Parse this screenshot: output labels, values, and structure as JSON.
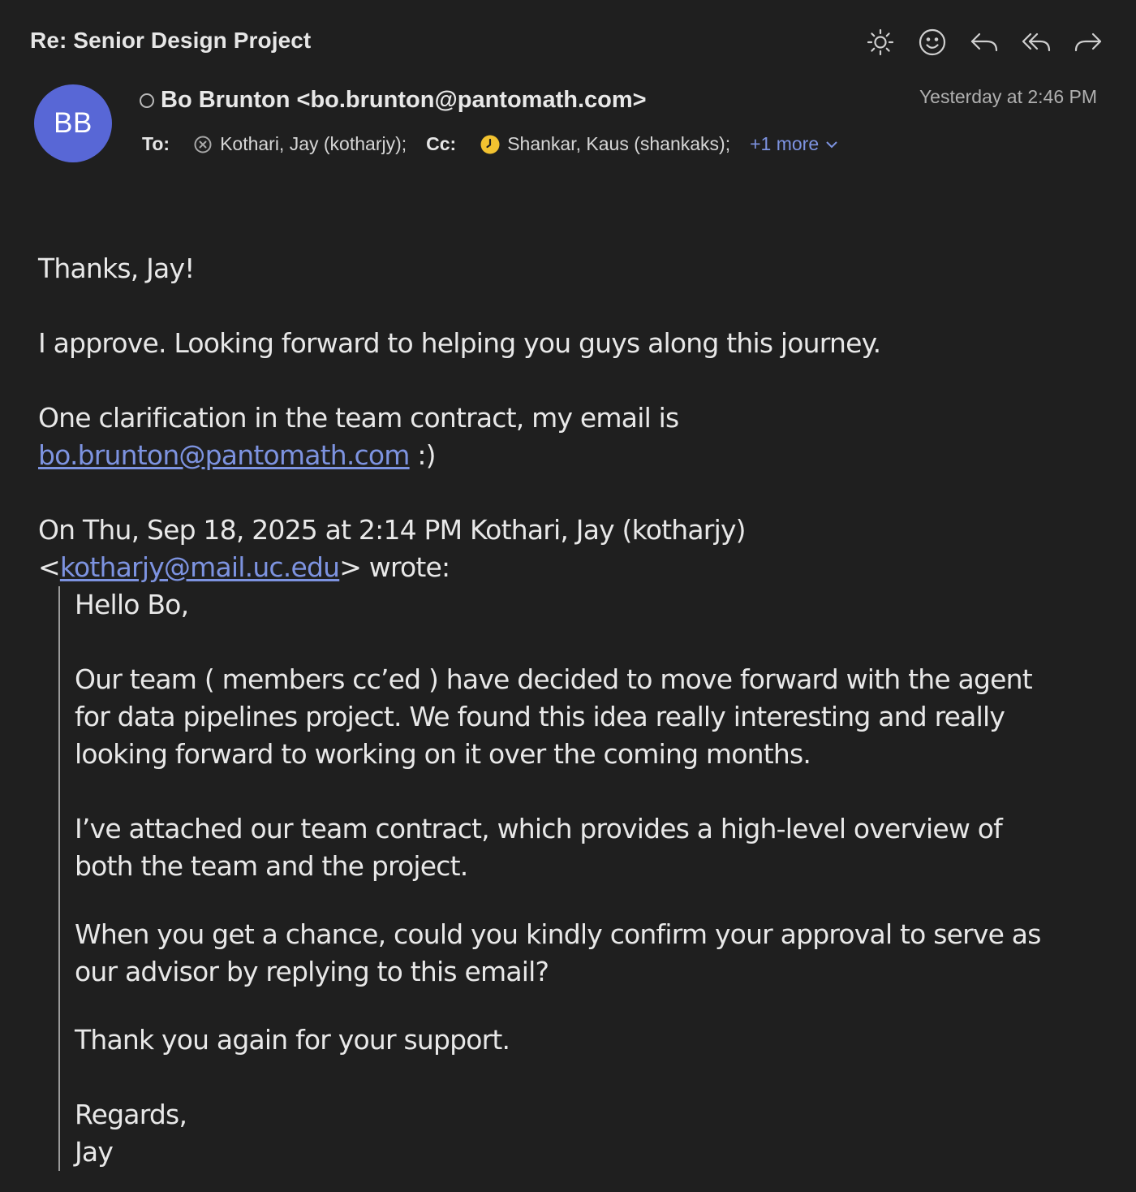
{
  "header": {
    "subject": "Re: Senior Design Project",
    "toolbar": [
      {
        "icon": "sun-icon",
        "name": "appearance-button"
      },
      {
        "icon": "smiley-icon",
        "name": "react-button"
      },
      {
        "icon": "reply-icon",
        "name": "reply-button"
      },
      {
        "icon": "reply-all-icon",
        "name": "reply-all-button"
      },
      {
        "icon": "forward-icon",
        "name": "forward-button"
      }
    ]
  },
  "sender": {
    "initials": "BB",
    "avatar_color": "#5867d6",
    "display": "Bo Brunton <bo.brunton@pantomath.com>",
    "timestamp": "Yesterday at 2:46 PM"
  },
  "recipients": {
    "to_label": "To:",
    "to": "Kothari, Jay (kotharjy);",
    "cc_label": "Cc:",
    "cc": "Shankar, Kaus (shankaks);",
    "more": "+1 more"
  },
  "message": {
    "greeting": "Thanks, Jay!",
    "line1": "I approve. Looking forward to helping you guys along this journey.",
    "line2": "One clarification in the team contract, my email is",
    "email_link": "bo.brunton@pantomath.com",
    "email_suffix": " :)",
    "attribution": "On Thu, Sep 18, 2025 at 2:14 PM Kothari, Jay (kotharjy)",
    "attr_open": "<",
    "attr_email": "kotharjy@mail.uc.edu",
    "attr_close": "> wrote:"
  },
  "quoted": {
    "greeting": "Hello Bo,",
    "p1": "Our team ( members cc’ed ) have decided to move forward with the agent for data pipelines project. We found this idea really interesting and really looking forward to working on it over the coming months.",
    "p2": "I’ve attached our team contract, which provides a high-level overview of both the team and the project.",
    "p3": "When you get a chance, could you kindly confirm your approval to serve as our advisor by replying to this email?",
    "p4": "Thank you again for your support.",
    "closing": "Regards,",
    "signature": "Jay"
  },
  "colors": {
    "background": "#1f1f1f",
    "link": "#7d93e0",
    "cc_status": "#f2c230"
  }
}
